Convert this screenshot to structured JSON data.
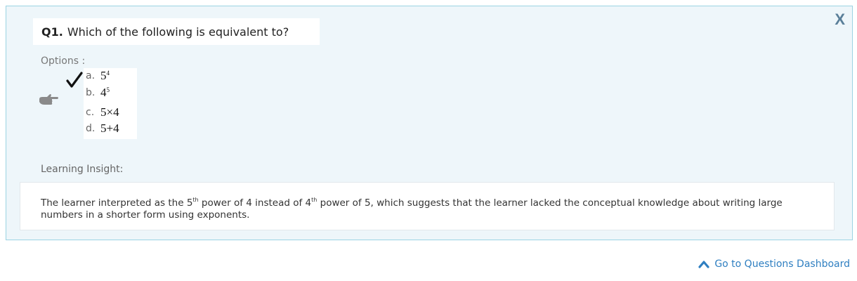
{
  "close": {
    "label": "X"
  },
  "question": {
    "number": "Q1.",
    "text": "Which of the following is equivalent to?"
  },
  "options": {
    "heading": "Options :",
    "items": [
      {
        "letter": "a.",
        "base": "5",
        "op": "",
        "sup": "4",
        "correct": true,
        "selected": false
      },
      {
        "letter": "b.",
        "base": "4",
        "op": "",
        "sup": "5",
        "correct": false,
        "selected": true
      },
      {
        "letter": "c.",
        "base": "5×4",
        "op": "",
        "sup": "",
        "correct": false,
        "selected": false
      },
      {
        "letter": "d.",
        "base": "5+4",
        "op": "",
        "sup": "",
        "correct": false,
        "selected": false
      }
    ],
    "icons": {
      "correct": "check-icon",
      "selected": "pointing-hand-icon"
    }
  },
  "insight": {
    "heading": "Learning Insight:",
    "part1": "The learner interpreted as the 5",
    "sup1": "th",
    "part2": " power of 4 instead of 4",
    "sup2": "th",
    "part3": " power of 5, which suggests that the learner lacked the conceptual knowledge about writing large numbers in a shorter form using exponents."
  },
  "footer": {
    "link_label": "Go to Questions Dashboard",
    "link_icon": "chevron-up-icon"
  },
  "colors": {
    "panel_bg": "#eef6fa",
    "panel_border": "#9bd3e3",
    "close": "#5a7f99",
    "link": "#2f7fc1"
  }
}
